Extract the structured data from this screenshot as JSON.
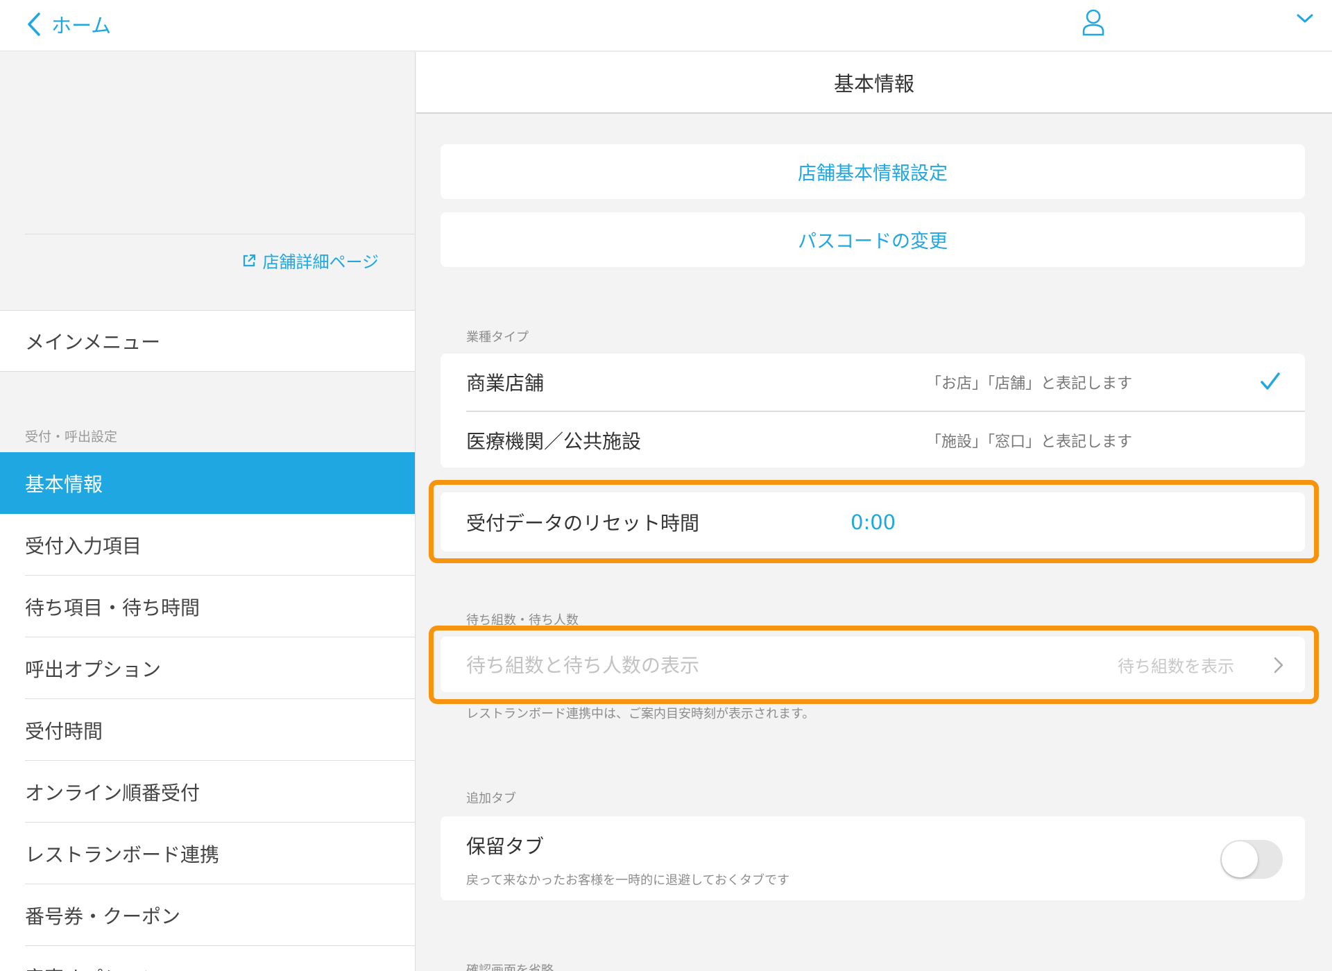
{
  "topbar": {
    "back_label": "ホーム"
  },
  "sidebar": {
    "store_link": "店舗詳細ページ",
    "main_menu": "メインメニュー",
    "section_label": "受付・呼出設定",
    "items": [
      {
        "label": "基本情報"
      },
      {
        "label": "受付入力項目"
      },
      {
        "label": "待ち項目・待ち時間"
      },
      {
        "label": "呼出オプション"
      },
      {
        "label": "受付時間"
      },
      {
        "label": "オンライン順番受付"
      },
      {
        "label": "レストランボード連携"
      },
      {
        "label": "番号券・クーポン"
      },
      {
        "label": "音声オプション"
      }
    ]
  },
  "main": {
    "title": "基本情報",
    "buttons": {
      "store_settings": "店舗基本情報設定",
      "passcode": "パスコードの変更"
    },
    "business_type": {
      "label": "業種タイプ",
      "options": [
        {
          "name": "商業店舗",
          "desc": "「お店」「店舗」と表記します"
        },
        {
          "name": "医療機関／公共施設",
          "desc": "「施設」「窓口」と表記します"
        }
      ]
    },
    "reset": {
      "label": "受付データのリセット時間",
      "value": "0:00"
    },
    "waiting": {
      "label": "待ち組数・待ち人数",
      "row_label": "待ち組数と待ち人数の表示",
      "row_value": "待ち組数を表示",
      "note": "レストランボード連携中は、ご案内目安時刻が表示されます。"
    },
    "extra_tabs": {
      "label": "追加タブ",
      "hold_title": "保留タブ",
      "hold_desc": "戻って来なかったお客様を一時的に退避しておくタブです",
      "hold_enabled": false
    },
    "next_section_label": "確認画面を省略"
  },
  "colors": {
    "accent": "#1ea7e1",
    "highlight": "#f7940f"
  }
}
